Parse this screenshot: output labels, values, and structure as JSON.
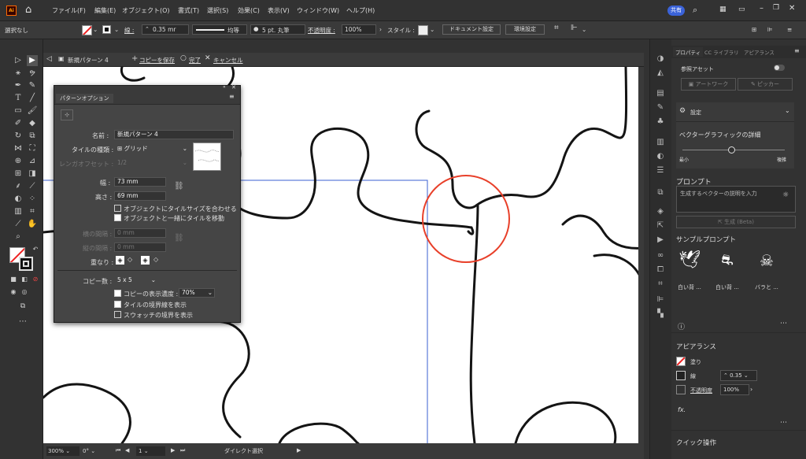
{
  "menu": {
    "items": [
      "ファイル(F)",
      "編集(E)",
      "オブジェクト(O)",
      "書式(T)",
      "選択(S)",
      "効果(C)",
      "表示(V)",
      "ウィンドウ(W)",
      "ヘルプ(H)"
    ],
    "share_label": "共有"
  },
  "control": {
    "selection": "選択なし",
    "stroke_label": "線 :",
    "stroke_value": "0.35 mr",
    "profile": "均等",
    "brush": "5 pt. 丸筆",
    "opacity_label": "不透明度 :",
    "opacity_value": "100%",
    "style_label": "スタイル :",
    "doc_setup": "ドキュメント設定",
    "prefs": "環境設定"
  },
  "docbar": {
    "pattern_name": "新規パターン 4",
    "save_copy": "コピーを保存",
    "done": "完了",
    "cancel": "キャンセル"
  },
  "dialog": {
    "tab": "パターンオプション",
    "name_label": "名前 :",
    "name_value": "新規パターン 4",
    "tile_type_label": "タイルの種類 :",
    "tile_type_value": "グリッド",
    "brick_offset_label": "レンガオフセット :",
    "brick_offset_value": "1/2",
    "width_label": "幅 :",
    "width_value": "73 mm",
    "height_label": "高さ :",
    "height_value": "69 mm",
    "fit_tile": "オブジェクトにタイルサイズを合わせる",
    "move_tile": "オブジェクトと一緒にタイルを移動",
    "h_spacing_label": "横の間隔 :",
    "h_spacing_value": "0 mm",
    "v_spacing_label": "縦の間隔 :",
    "v_spacing_value": "0 mm",
    "overlap_label": "重なり :",
    "copies_label": "コピー数 :",
    "copies_value": "5 x 5",
    "dim_copies_label": "コピーの表示濃度 :",
    "dim_copies_value": "70%",
    "show_tile_edge": "タイルの境界線を表示",
    "show_swatch_bounds": "スウォッチの境界を表示"
  },
  "status": {
    "zoom": "300%",
    "angle": "0°",
    "artboard": "1",
    "tool": "ダイレクト選択"
  },
  "rpanel": {
    "tabs": [
      "プロパティ",
      "CC ライブラリ",
      "アピアランス"
    ],
    "ref_asset": "参照アセット",
    "artwork": "アートワーク",
    "picker": "ピッカー",
    "settings": "設定",
    "vector_detail": "ベクターグラフィックの詳細",
    "min": "最小",
    "max": "複雑",
    "prompt_title": "プロンプト",
    "prompt_placeholder": "生成するベクターの説明を入力",
    "generate": "生成 (Beta)",
    "sample_prompts": "サンプルプロンプト",
    "samples": [
      "白い背 ...",
      "白い背 ...",
      "バラと ..."
    ],
    "appearance": "アピアランス",
    "fill": "塗り",
    "stroke": "線",
    "stroke_value": "0.35",
    "opacity_label": "不透明度",
    "opacity_value": "100%",
    "fx": "fx.",
    "quick_actions": "クイック操作"
  },
  "colors": {
    "accent": "#e8402a",
    "share": "#3b63d9",
    "panel": "#454545"
  }
}
